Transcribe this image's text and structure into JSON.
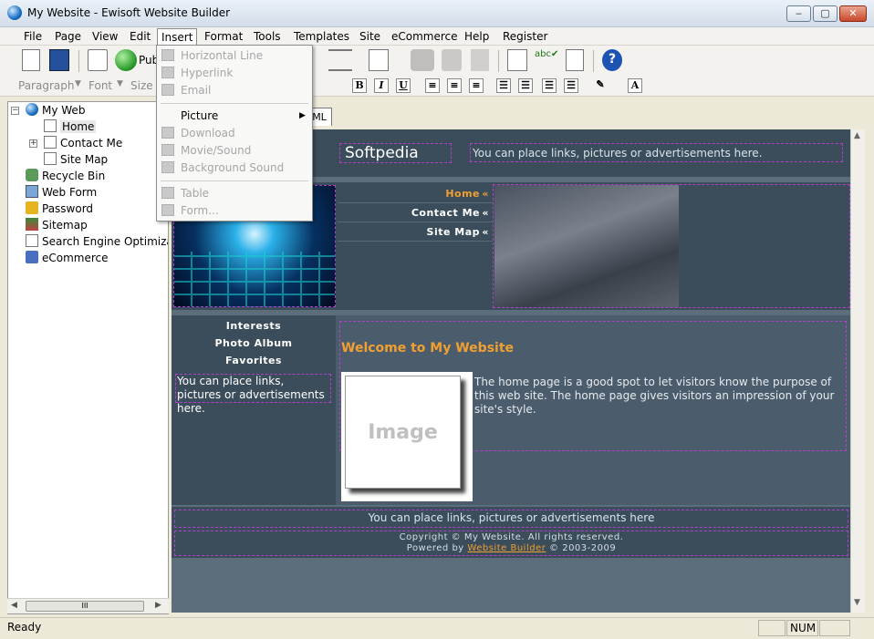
{
  "window": {
    "title": "My Website - Ewisoft Website Builder",
    "minimize": "‒",
    "maximize": "▢",
    "close": "✕"
  },
  "menubar": [
    "File",
    "Page",
    "View",
    "Edit",
    "Insert",
    "Format",
    "Tools",
    "Templates",
    "Site",
    "eCommerce",
    "Help",
    "Register"
  ],
  "toolbar": {
    "publish_label": "Pub"
  },
  "format_bar": {
    "paragraph": "Paragraph",
    "font": "Font",
    "size": "Size",
    "bold": "B",
    "italic": "I",
    "underline": "U"
  },
  "tree": {
    "items": [
      {
        "label": "My Web",
        "icon": "globe-icon"
      },
      {
        "label": "Home",
        "icon": "page-icon"
      },
      {
        "label": "Contact Me",
        "icon": "page-icon"
      },
      {
        "label": "Site Map",
        "icon": "page-icon"
      },
      {
        "label": "Recycle Bin",
        "icon": "recycle-bin-icon"
      },
      {
        "label": "Web Form",
        "icon": "form-icon"
      },
      {
        "label": "Password",
        "icon": "lock-icon"
      },
      {
        "label": "Sitemap",
        "icon": "sitemap-icon"
      },
      {
        "label": "Search Engine Optimizati",
        "icon": "search-engine-icon"
      },
      {
        "label": "eCommerce",
        "icon": "cart-icon"
      }
    ],
    "scroll_grip": "III"
  },
  "editor": {
    "tab_label": "ML"
  },
  "site": {
    "title": "Softpedia",
    "header_ad": "You can place links, pictures or advertisements here.",
    "nav": [
      "Home",
      "Contact Me",
      "Site Map"
    ],
    "nav_arrow": "«",
    "side_links": [
      "Interests",
      "Photo Album",
      "Favorites"
    ],
    "side_ad": "You can place links, pictures or advertisements here.",
    "welcome": "Welcome to My Website",
    "image_placeholder": "Image",
    "body_text": "The home page is a good spot to let visitors know the purpose of this web site. The home page gives visitors an impression of your site's style.",
    "footer_ad": "You can place links, pictures or advertisements here",
    "copyright": "Copyright © My Website. All rights reserved.",
    "powered_prefix": "Powered by",
    "powered_link": "Website Builder",
    "powered_suffix": "© 2003-2009",
    "colors": {
      "page": "#3b4d5b",
      "accent": "#f0a030",
      "outline": "#b040c8"
    }
  },
  "insert_menu": {
    "items": [
      {
        "label": "Horizontal Line",
        "enabled": false,
        "icon": "horizontal-line-icon"
      },
      {
        "label": "Hyperlink",
        "enabled": false,
        "icon": "hyperlink-icon"
      },
      {
        "label": "Email",
        "enabled": false,
        "icon": "email-icon"
      },
      {
        "label": "Picture",
        "enabled": true,
        "submenu": true,
        "icon": ""
      },
      {
        "label": "Download",
        "enabled": false,
        "icon": "download-icon"
      },
      {
        "label": "Movie/Sound",
        "enabled": false,
        "icon": "movie-icon"
      },
      {
        "label": "Background Sound",
        "enabled": false,
        "icon": "sound-icon"
      },
      {
        "label": "Table",
        "enabled": false,
        "icon": "table-icon"
      },
      {
        "label": "Form...",
        "enabled": false,
        "icon": "form-icon"
      }
    ],
    "submenu_arrow": "▶"
  },
  "status": {
    "text": "Ready",
    "num": "NUM"
  }
}
